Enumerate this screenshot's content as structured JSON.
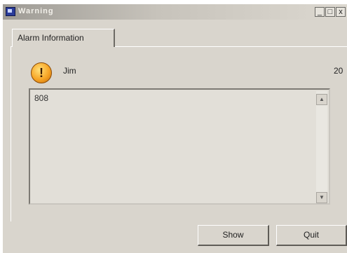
{
  "window": {
    "title": "Warning",
    "controls": {
      "minimize": "_",
      "maximize": "□",
      "close": "x"
    }
  },
  "tabs": [
    {
      "label": "Alarm Information",
      "active": true
    }
  ],
  "alarm": {
    "icon": "warning-shield-icon",
    "user": "Jim",
    "count": "20",
    "message": "808"
  },
  "buttons": {
    "show": "Show",
    "quit": "Quit"
  },
  "scrollbar": {
    "up": "▲",
    "down": "▼"
  }
}
